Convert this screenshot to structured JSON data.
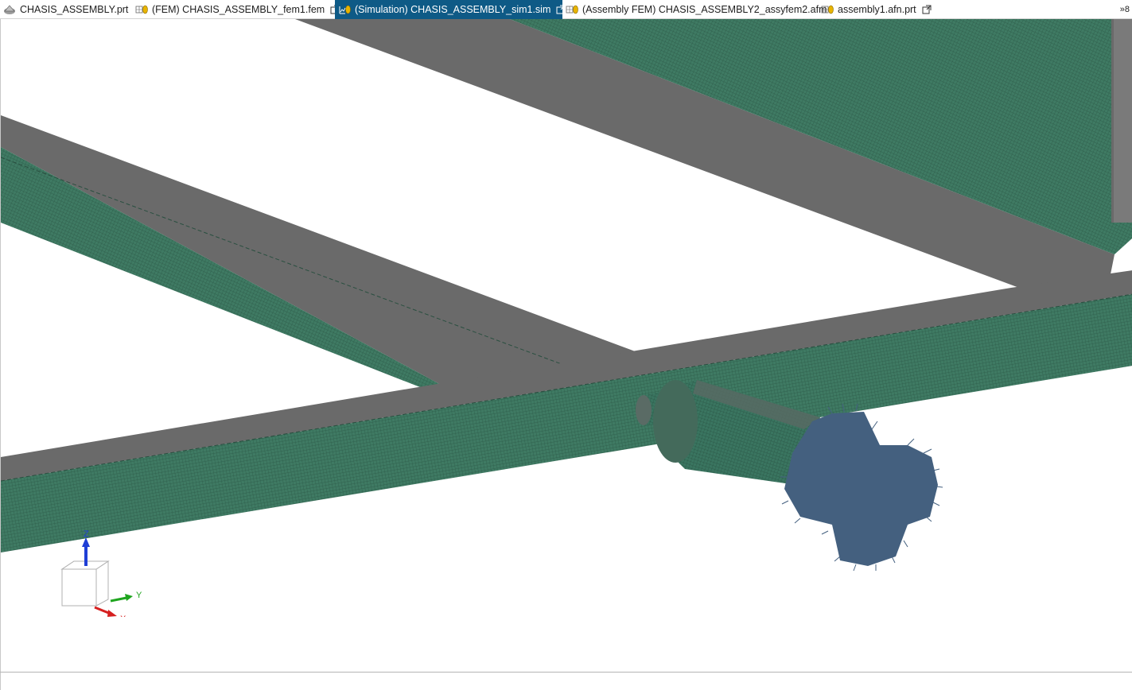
{
  "tabs": [
    {
      "label": "CHASIS_ASSEMBLY.prt",
      "icon": "part-icon",
      "active": false
    },
    {
      "label": "(FEM) CHASIS_ASSEMBLY_fem1.fem",
      "icon": "fem-icon",
      "active": false
    },
    {
      "label": "(Simulation) CHASIS_ASSEMBLY_sim1.sim",
      "icon": "simulation-icon",
      "active": true
    },
    {
      "label": "(Assembly FEM) CHASIS_ASSEMBLY2_assyfem2.afm",
      "icon": "assembly-fem-icon",
      "active": false
    },
    {
      "label": "assembly1.afn.prt",
      "icon": "fem-icon",
      "active": false
    }
  ],
  "tab_overflow": {
    "label": "»8"
  },
  "viewport": {
    "mesh_color": "#3f7a63",
    "mesh_line_color": "#2c5a48",
    "flange_color": "#6a6a6a",
    "load_arrow_color": "#44607f"
  },
  "triad": {
    "z_label": "Z",
    "y_label": "Y",
    "x_label": "X",
    "z_color": "#1f3fd6",
    "y_color": "#1fa51f",
    "x_color": "#d62020"
  },
  "colors": {
    "active_tab_bg": "#0e5a86",
    "background": "#ffffff"
  }
}
